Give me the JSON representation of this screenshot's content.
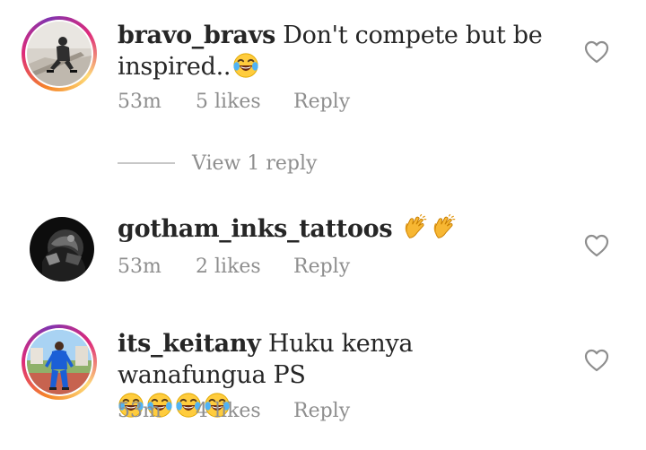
{
  "comments": [
    {
      "username": "bravo_bravs",
      "text_line1": "Don't compete but be",
      "text_line2": "inspired..",
      "emojis": [
        "laughing-crying"
      ],
      "time": "53m",
      "likes": "5 likes",
      "reply_label": "Reply",
      "has_story_ring": true
    },
    {
      "username": "gotham_inks_tattoos",
      "text_line1": "",
      "emojis": [
        "clapping-hands",
        "clapping-hands"
      ],
      "time": "53m",
      "likes": "2 likes",
      "reply_label": "Reply",
      "has_story_ring": false
    },
    {
      "username": "its_keitany",
      "text_line1": "Huku kenya wanafungua PS",
      "emojis": [
        "laughing-crying",
        "laughing-crying",
        "laughing-crying",
        "laughing-crying"
      ],
      "time": "53m",
      "likes": "4 likes",
      "reply_label": "Reply",
      "has_story_ring": true
    }
  ],
  "view_replies_label": "View 1 reply",
  "icons": {
    "like": "heart-outline-icon"
  },
  "colors": {
    "text": "#262626",
    "muted": "#8e8e8e",
    "ring_start": "#f58529",
    "ring_mid": "#dd2a7b",
    "ring_end": "#8134af"
  }
}
